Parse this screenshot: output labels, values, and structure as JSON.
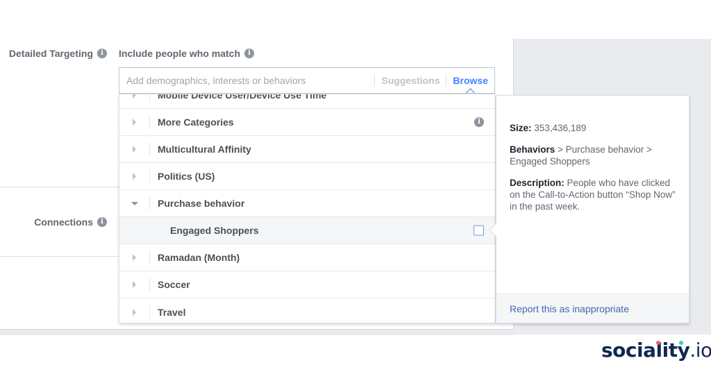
{
  "form": {
    "detailed_targeting_label": "Detailed Targeting",
    "include_label": "Include people who match",
    "connections_label": "Connections"
  },
  "search": {
    "placeholder": "Add demographics, interests or behaviors",
    "value": "",
    "tabs": [
      {
        "label": "Suggestions",
        "active": false
      },
      {
        "label": "Browse",
        "active": true
      }
    ]
  },
  "browse_list": {
    "items": [
      {
        "label": "Mobile Device User/Device Use Time",
        "expanded": false,
        "partial": true
      },
      {
        "label": "More Categories",
        "expanded": false,
        "icon": "info-icon"
      },
      {
        "label": "Multicultural Affinity",
        "expanded": false
      },
      {
        "label": "Politics (US)",
        "expanded": false
      },
      {
        "label": "Purchase behavior",
        "expanded": true
      },
      {
        "label": "Engaged Shoppers",
        "child": true,
        "checked": false
      },
      {
        "label": "Ramadan (Month)",
        "expanded": false
      },
      {
        "label": "Soccer",
        "expanded": false
      },
      {
        "label": "Travel",
        "expanded": false
      }
    ]
  },
  "detail": {
    "size_label": "Size:",
    "size_value": "353,436,189",
    "path_root": "Behaviors",
    "path_rest": " > Purchase behavior > Engaged Shoppers",
    "description_label": "Description:",
    "description_text": " People who have clicked on the Call-to-Action button “Shop Now” in the past week.",
    "report_link": "Report this as inappropriate"
  },
  "brand": {
    "name": "sociality",
    "suffix": ".io",
    "dot_colors": [
      "#f05a5a",
      "#3fd1a8"
    ]
  },
  "colors": {
    "accent": "#4080ff",
    "link": "#4267b2",
    "brand": "#112850"
  }
}
